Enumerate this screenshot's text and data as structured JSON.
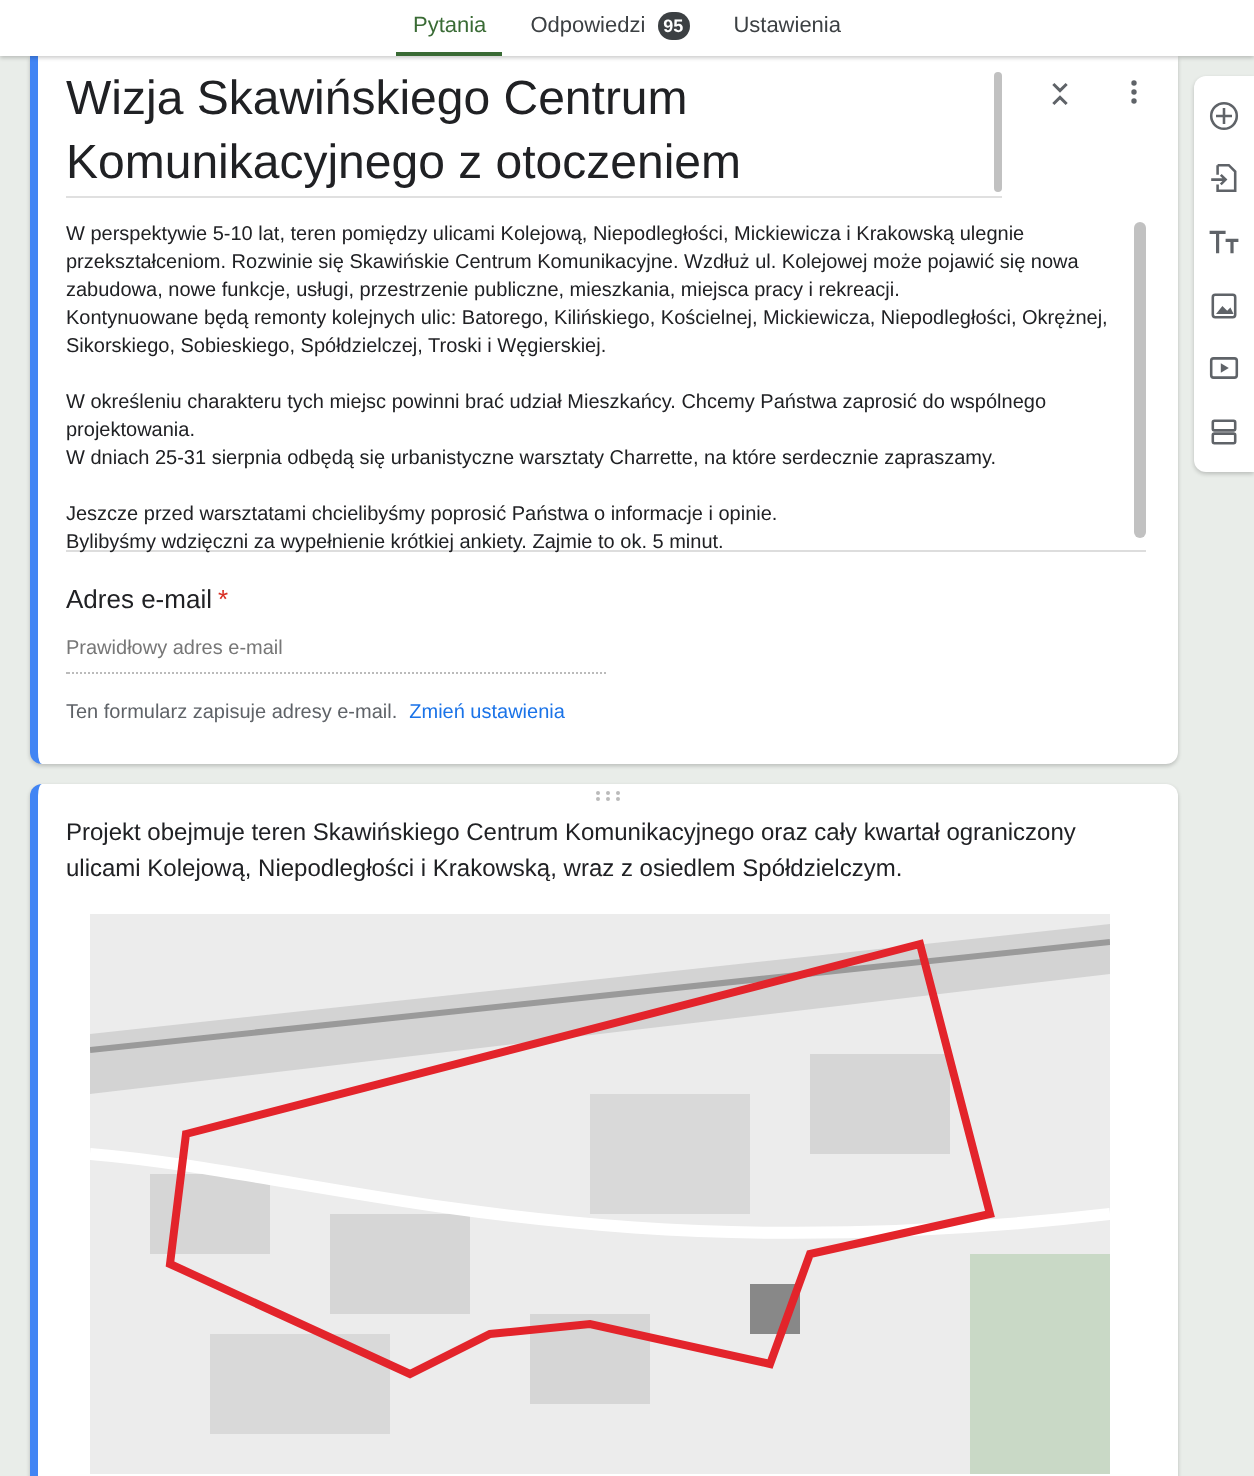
{
  "tabs": [
    {
      "label": "Pytania",
      "selected": true
    },
    {
      "label": "Odpowiedzi",
      "selected": false,
      "badge": "95"
    },
    {
      "label": "Ustawienia",
      "selected": false
    }
  ],
  "header_card": {
    "title": "Wizja Skawińskiego Centrum Komunikacyjnego z otoczeniem",
    "description": "W perspektywie 5-10 lat, teren pomiędzy ulicami Kolejową, Niepodległości, Mickiewicza i Krakowską ulegnie przekształceniom. Rozwinie się Skawińskie Centrum Komunikacyjne. Wzdłuż ul. Kolejowej może pojawić się nowa zabudowa, nowe funkcje, usługi, przestrzenie publiczne, mieszkania, miejsca pracy i rekreacji.\nKontynuowane będą remonty kolejnych ulic: Batorego, Kilińskiego, Kościelnej, Mickiewicza, Niepodległości, Okrężnej, Sikorskiego, Sobieskiego, Spółdzielczej, Troski i Węgierskiej.\n\nW określeniu charakteru tych miejsc powinni brać udział Mieszkańcy. Chcemy Państwa zaprosić do wspólnego projektowania.\nW dniach 25-31 sierpnia odbędą się urbanistyczne warsztaty Charrette, na które serdecznie zapraszamy.\n\nJeszcze przed warsztatami chcielibyśmy poprosić Państwa o informacje i opinie.\nBylibyśmy wdzięczni za wypełnienie krótkiej ankiety. Zajmie to ok. 5 minut.",
    "email_label": "Adres e-mail",
    "required_mark": "*",
    "email_placeholder": "Prawidłowy adres e-mail",
    "note": "Ten formularz zapisuje adresy e-mail.",
    "note_link": "Zmień ustawienia"
  },
  "content_card": {
    "text": "Projekt obejmuje teren Skawińskiego Centrum Komunikacyjnego oraz cały kwartał ograniczony ulicami Kolejową, Niepodległości i Krakowską, wraz z osiedlem Spółdzielczym."
  }
}
